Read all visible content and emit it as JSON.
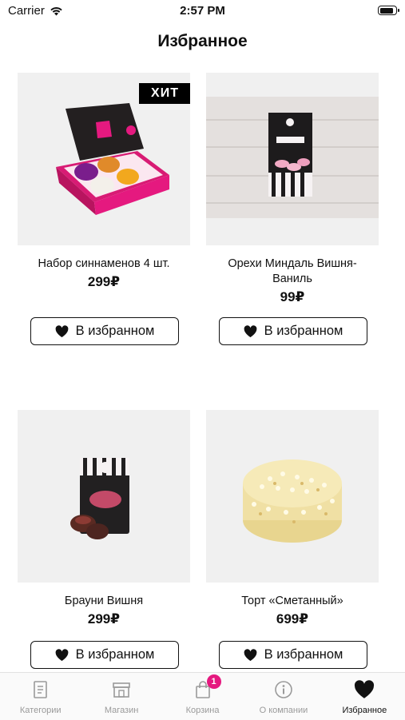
{
  "status_bar": {
    "carrier": "Carrier",
    "time": "2:57 PM",
    "battery_level": 0.9
  },
  "header": {
    "title": "Избранное"
  },
  "products": [
    {
      "name": "Набор синнаменов 4 шт.",
      "price": "299₽",
      "badge": "ХИТ",
      "favorite_label": "В избранном",
      "image": "cinnamon-box"
    },
    {
      "name": "Орехи Миндаль Вишня-Ваниль",
      "price": "99₽",
      "favorite_label": "В избранном",
      "image": "almond-bag"
    },
    {
      "name": "Брауни Вишня",
      "price": "299₽",
      "favorite_label": "В избранном",
      "image": "brownie-bag"
    },
    {
      "name": "Торт «Сметанный»",
      "price": "699₽",
      "favorite_label": "В избранном",
      "image": "sour-cream-cake"
    }
  ],
  "tabbar": {
    "items": [
      {
        "label": "Категории",
        "icon": "catalog-icon"
      },
      {
        "label": "Магазин",
        "icon": "store-icon"
      },
      {
        "label": "Корзина",
        "icon": "cart-icon",
        "badge": "1"
      },
      {
        "label": "О компании",
        "icon": "info-icon"
      },
      {
        "label": "Избранное",
        "icon": "heart-icon",
        "active": true
      }
    ]
  },
  "colors": {
    "accent": "#e5197f",
    "text": "#111111",
    "inactive": "#9a9a9a",
    "card_bg": "#f0f0f0"
  }
}
